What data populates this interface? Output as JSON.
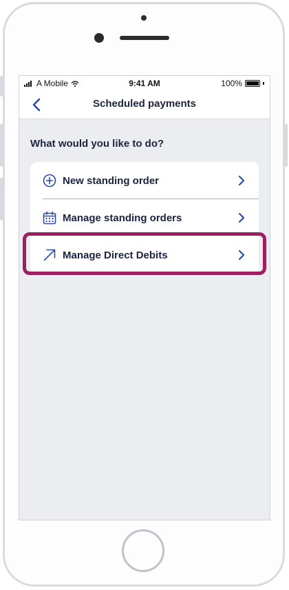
{
  "device": {
    "status_bar": {
      "carrier": "A Mobile",
      "time": "9:41 AM",
      "battery": "100%"
    }
  },
  "header": {
    "title": "Scheduled payments",
    "back_icon": "chevron-left-icon"
  },
  "main": {
    "question": "What would you like to do?",
    "options": [
      {
        "label": "New standing order",
        "icon": "plus-circle-icon"
      },
      {
        "label": "Manage standing orders",
        "icon": "calendar-icon"
      },
      {
        "label": "Manage Direct Debits",
        "icon": "arrow-up-right-icon"
      }
    ]
  },
  "colors": {
    "accent": "#2a4ab0",
    "text": "#1c2340",
    "highlight": "#9c1f5f",
    "background": "#ecedf1"
  }
}
